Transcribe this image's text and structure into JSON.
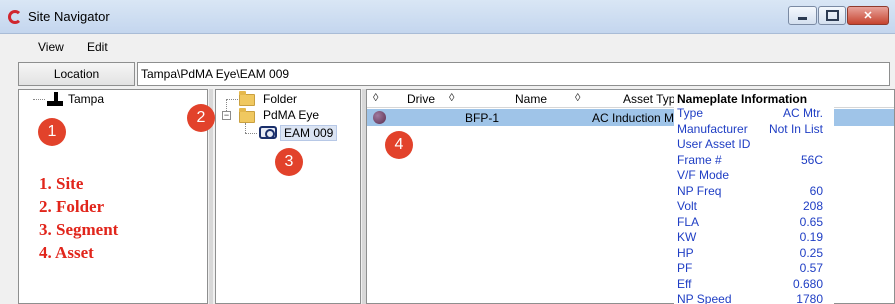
{
  "window": {
    "title": "Site Navigator"
  },
  "menu": {
    "items": [
      "View",
      "Edit"
    ]
  },
  "location": {
    "label": "Location",
    "value": "Tampa\\PdMA Eye\\EAM 009"
  },
  "site_tree": {
    "root": "Tampa"
  },
  "folder_tree": {
    "items": [
      {
        "label": "Folder"
      },
      {
        "label": "PdMA Eye"
      },
      {
        "label": "EAM 009"
      }
    ]
  },
  "callouts": [
    "1",
    "2",
    "3",
    "4"
  ],
  "legend": [
    "1. Site",
    "2. Folder",
    "3. Segment",
    "4. Asset"
  ],
  "asset_grid": {
    "sort_glyph": "◊",
    "columns": [
      "Drive",
      "Name",
      "Asset Typ"
    ],
    "row": {
      "name": "BFP-1",
      "asset_type": "AC Induction M"
    }
  },
  "nameplate": {
    "title": "Nameplate Information",
    "rows": [
      {
        "key": "Type",
        "value": "AC Mtr."
      },
      {
        "key": "Manufacturer",
        "value": "Not In List"
      },
      {
        "key": "User Asset ID",
        "value": ""
      },
      {
        "key": "Frame #",
        "value": "56C"
      },
      {
        "key": "V/F Mode",
        "value": ""
      },
      {
        "key": "NP Freq",
        "value": "60"
      },
      {
        "key": "Volt",
        "value": "208"
      },
      {
        "key": "FLA",
        "value": "0.65"
      },
      {
        "key": "KW",
        "value": "0.19"
      },
      {
        "key": "HP",
        "value": "0.25"
      },
      {
        "key": "PF",
        "value": "0.57"
      },
      {
        "key": "Eff",
        "value": "0.680"
      },
      {
        "key": "NP Speed",
        "value": "1780"
      }
    ]
  },
  "colors": {
    "callout": "#e2422b",
    "legend": "#e1251b",
    "nameplate_text": "#1f3ec4",
    "row_selected": "#9fc4e8"
  }
}
